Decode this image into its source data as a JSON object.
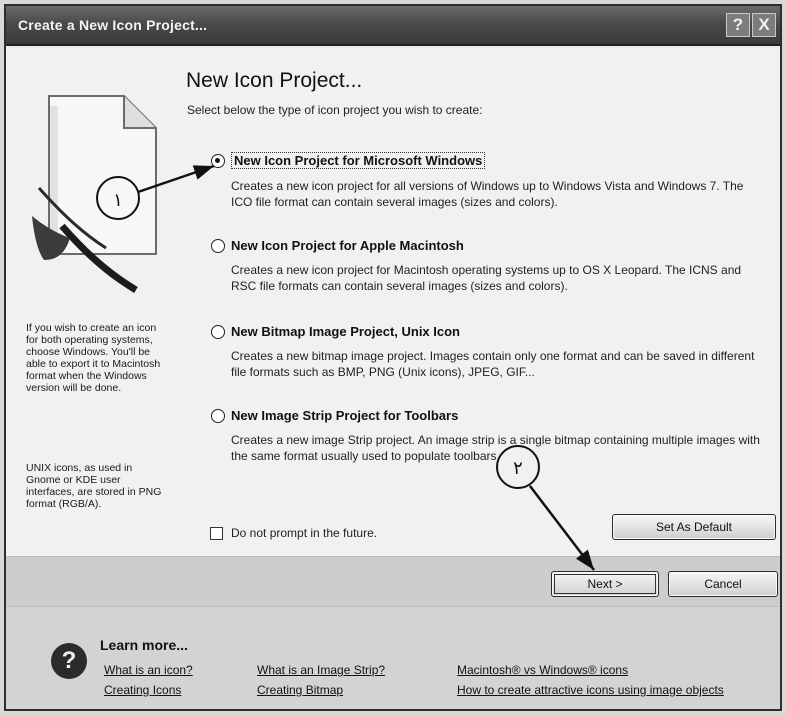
{
  "window": {
    "title": "Create a New Icon Project...",
    "help_glyph": "?",
    "close_glyph": "X"
  },
  "main": {
    "heading": "New Icon Project...",
    "subheading": "Select below the type of icon project you wish to create:",
    "options": [
      {
        "label": "New Icon Project for Microsoft Windows",
        "description": "Creates a new icon project for all versions of Windows up to Windows Vista and Windows 7. The ICO file format can contain several images (sizes and colors).",
        "selected": true
      },
      {
        "label": "New Icon Project for Apple Macintosh",
        "description": "Creates a new icon project for Macintosh operating systems up to OS X Leopard. The ICNS and RSC file formats can contain several images (sizes and colors).",
        "selected": false
      },
      {
        "label": "New Bitmap Image Project, Unix Icon",
        "description": "Creates a new bitmap image project. Images contain only one format and can be saved in different file formats such as BMP, PNG (Unix icons), JPEG, GIF...",
        "selected": false
      },
      {
        "label": "New Image Strip Project for Toolbars",
        "description": "Creates a new image Strip project. An image strip is a single bitmap containing multiple images with the same format usually used to populate toolbars.",
        "selected": false
      }
    ],
    "do_not_prompt": "Do not prompt in the future.",
    "set_as_default": "Set As Default"
  },
  "sidebar": {
    "note_windows": "If you wish to create an icon for both operating systems, choose Windows. You'll be able to export it to Macintosh format when the Windows version will be done.",
    "note_unix": "UNIX icons, as used in Gnome or KDE user interfaces, are stored in PNG format (RGB/A)."
  },
  "buttons": {
    "next": "Next >",
    "cancel": "Cancel"
  },
  "annotations": {
    "callout_1": "١",
    "callout_2": "٢"
  },
  "footer": {
    "learn_more": "Learn more...",
    "links": [
      "What is an icon?",
      "Creating Icons",
      "What is an Image Strip?",
      "Creating Bitmap",
      "Macintosh® vs Windows® icons",
      "How to create attractive icons using image objects"
    ]
  }
}
